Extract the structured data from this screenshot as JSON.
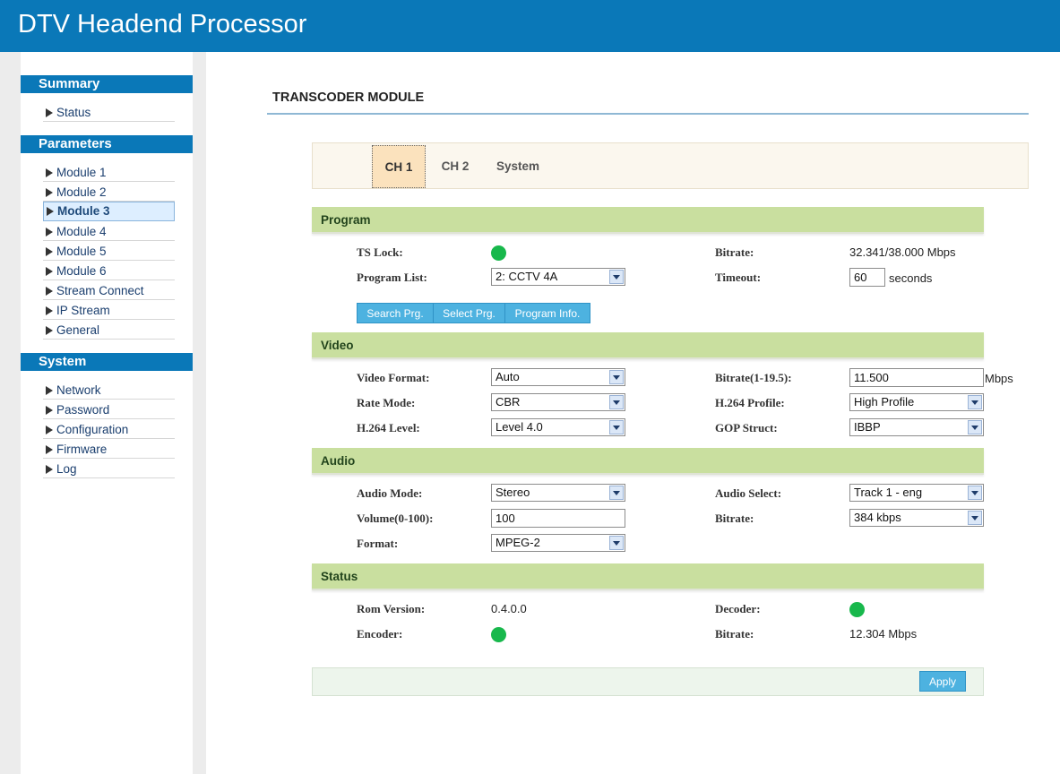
{
  "header": {
    "title": "DTV Headend Processor"
  },
  "sidebar": {
    "summary_title": "Summary",
    "summary_items": [
      "Status"
    ],
    "parameters_title": "Parameters",
    "parameters_items": [
      "Module 1",
      "Module 2",
      "Module 3",
      "Module 4",
      "Module 5",
      "Module 6",
      "Stream Connect",
      "IP Stream",
      "General"
    ],
    "active_item": "Module 3",
    "system_title": "System",
    "system_items": [
      "Network",
      "Password",
      "Configuration",
      "Firmware",
      "Log"
    ]
  },
  "main": {
    "title": "TRANSCODER MODULE",
    "tabs": [
      "CH 1",
      "CH 2",
      "System"
    ],
    "active_tab": "CH 1"
  },
  "program": {
    "section_label": "Program",
    "ts_lock_label": "TS Lock:",
    "bitrate_label": "Bitrate:",
    "bitrate_value": "32.341/38.000 Mbps",
    "program_list_label": "Program List:",
    "program_list_value": "2: CCTV 4A",
    "timeout_label": "Timeout:",
    "timeout_value": "60",
    "timeout_unit": "seconds",
    "buttons": {
      "search": "Search Prg.",
      "select": "Select Prg.",
      "info": "Program Info."
    }
  },
  "video": {
    "section_label": "Video",
    "format_label": "Video Format:",
    "format_value": "Auto",
    "bitrate_label": "Bitrate(1-19.5):",
    "bitrate_value": "11.500",
    "bitrate_unit": "Mbps",
    "rate_mode_label": "Rate Mode:",
    "rate_mode_value": "CBR",
    "profile_label": "H.264 Profile:",
    "profile_value": "High Profile",
    "level_label": "H.264 Level:",
    "level_value": "Level 4.0",
    "gop_label": "GOP Struct:",
    "gop_value": "IBBP"
  },
  "audio": {
    "section_label": "Audio",
    "mode_label": "Audio Mode:",
    "mode_value": "Stereo",
    "select_label": "Audio Select:",
    "select_value": "Track 1 - eng",
    "volume_label": "Volume(0-100):",
    "volume_value": "100",
    "bitrate_label": "Bitrate:",
    "bitrate_value": "384 kbps",
    "format_label": "Format:",
    "format_value": "MPEG-2"
  },
  "status": {
    "section_label": "Status",
    "rom_label": "Rom Version:",
    "rom_value": "0.4.0.0",
    "decoder_label": "Decoder:",
    "encoder_label": "Encoder:",
    "bitrate_label": "Bitrate:",
    "bitrate_value": "12.304 Mbps"
  },
  "apply_label": "Apply",
  "colors": {
    "header": "#0a78b8",
    "section": "#c9df9f",
    "led_ok": "#18b84c",
    "button": "#4db2e0"
  }
}
